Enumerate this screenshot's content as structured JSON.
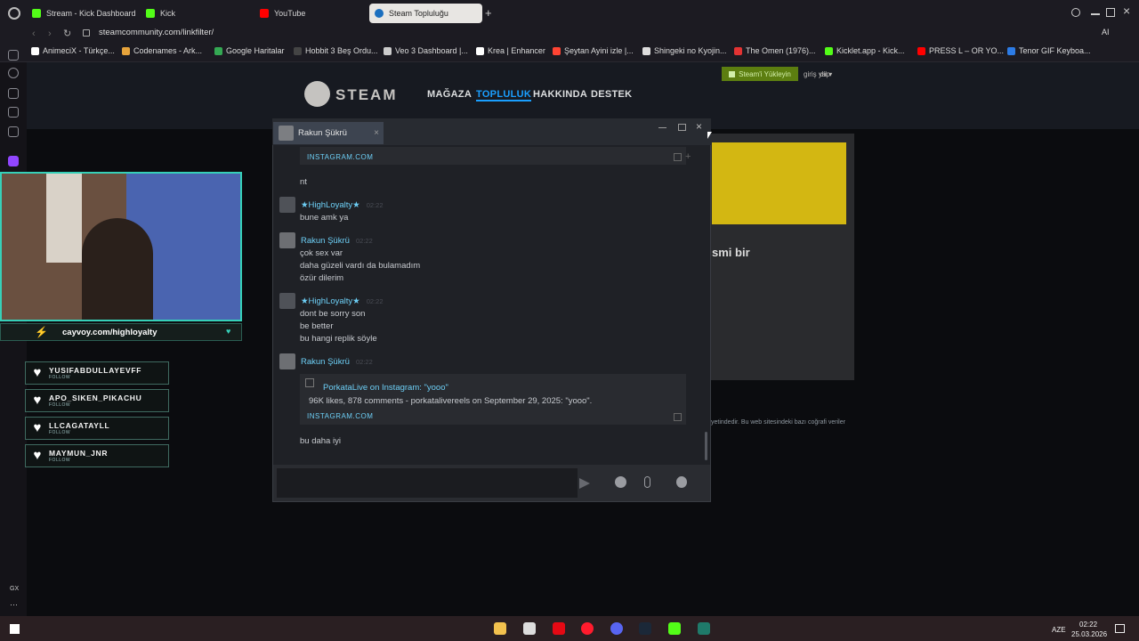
{
  "browser": {
    "tabs": [
      {
        "label": "Stream - Kick Dashboard",
        "color": "#53fc18"
      },
      {
        "label": "Kick",
        "color": "#53fc18"
      },
      {
        "label": "YouTube",
        "color": "#ff0000"
      },
      {
        "label": "Steam Topluluğu",
        "color": "#1b6fbf",
        "active": true
      }
    ],
    "address": "steamcommunity.com/linkfilter/",
    "bookmarks": [
      {
        "label": "AnimeciX - Türkçe...",
        "color": "#ffffff"
      },
      {
        "label": "Codenames - Ark...",
        "color": "#e6a33b"
      },
      {
        "label": "Google Haritalar",
        "color": "#34a853"
      },
      {
        "label": "Hobbit 3 Beş Ordu...",
        "color": "#444444"
      },
      {
        "label": "Veo 3 Dashboard |...",
        "color": "#cccccc"
      },
      {
        "label": "Krea | Enhancer",
        "color": "#ffffff"
      },
      {
        "label": "Şeytan Ayini izle |...",
        "color": "#ff4433"
      },
      {
        "label": "Shingeki no Kyojin...",
        "color": "#dddddd"
      },
      {
        "label": "The Omen (1976)...",
        "color": "#e33333"
      },
      {
        "label": "Kicklet.app - Kick...",
        "color": "#53fc18"
      },
      {
        "label": "PRESS L – OR YO...",
        "color": "#ff0000"
      },
      {
        "label": "Tenor GIF Keyboa...",
        "color": "#2c7be5"
      }
    ]
  },
  "steam": {
    "logo": "STEAM",
    "nav": [
      "MAĞAZA",
      "TOPLULUK",
      "HAKKINDA",
      "DESTEK"
    ],
    "install": "Steam'i Yükleyin",
    "login": "giriş yap",
    "lang": "dil",
    "partial_heading": "smi bir",
    "footer_partial": "yetindedir. Bu web sitesindeki bazı coğrafi veriler"
  },
  "chat": {
    "tab_name": "Rakun Şükrü",
    "top_link": "INSTAGRAM.COM",
    "messages": [
      {
        "author": "",
        "lines": [
          "nt"
        ]
      },
      {
        "author": "★HighLoyalty★",
        "time": "02:22",
        "lines": [
          "bune amk ya"
        ]
      },
      {
        "author": "Rakun Şükrü",
        "time": "02:22",
        "lines": [
          "çok sex var",
          "daha güzeli vardı da bulamadım",
          "özür dilerim"
        ]
      },
      {
        "author": "★HighLoyalty★",
        "time": "02:22",
        "lines": [
          "dont be sorry son",
          "be better",
          "bu hangi replik söyle"
        ]
      },
      {
        "author": "Rakun Şükrü",
        "time": "02:22",
        "lines": []
      }
    ],
    "embed": {
      "title": "PorkataLive on Instagram: \"yooo\"",
      "desc": "96K likes, 878 comments - porkatalivereels on September 29, 2025: \"yooo\".",
      "domain": "INSTAGRAM.COM"
    },
    "last_line": "bu daha iyi"
  },
  "overlay": {
    "brand_url": "cayvoy.com/highloyalty",
    "followers": [
      {
        "name": "YUSIFABDULLAYEVFF",
        "sub": "FOLLOW"
      },
      {
        "name": "APO_SIKEN_PIKACHU",
        "sub": "FOLLOW"
      },
      {
        "name": "LLCAGATAYLL",
        "sub": "FOLLOW"
      },
      {
        "name": "MAYMUN_JNR",
        "sub": "FOLLOW"
      }
    ]
  },
  "taskbar": {
    "lang": "AZE",
    "time": "02:22",
    "date": "25.03.2026"
  },
  "rail": {
    "gx": "GX"
  }
}
